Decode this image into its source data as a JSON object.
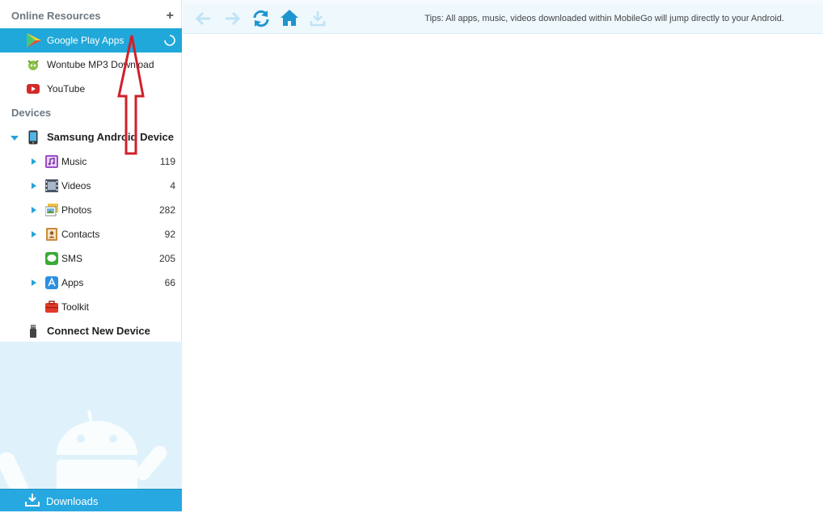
{
  "sidebar": {
    "online_resources": {
      "title": "Online Resources",
      "add_label": "+",
      "items": [
        {
          "label": "Google Play Apps",
          "icon": "google-play-icon",
          "active": true
        },
        {
          "label": "Wontube MP3 Download",
          "icon": "wontube-icon"
        },
        {
          "label": "YouTube",
          "icon": "youtube-icon"
        }
      ]
    },
    "devices": {
      "title": "Devices",
      "device_name": "Samsung Android Device",
      "categories": [
        {
          "label": "Music",
          "count": "119",
          "icon": "music-icon"
        },
        {
          "label": "Videos",
          "count": "4",
          "icon": "video-icon"
        },
        {
          "label": "Photos",
          "count": "282",
          "icon": "photos-icon"
        },
        {
          "label": "Contacts",
          "count": "92",
          "icon": "contacts-icon"
        },
        {
          "label": "SMS",
          "count": "205",
          "icon": "sms-icon"
        },
        {
          "label": "Apps",
          "count": "66",
          "icon": "apps-icon"
        },
        {
          "label": "Toolkit",
          "count": "",
          "icon": "toolkit-icon"
        }
      ],
      "connect_label": "Connect New Device"
    },
    "downloads_label": "Downloads"
  },
  "toolbar": {
    "tips": "Tips: All apps, music, videos downloaded within MobileGo will jump directly to your Android."
  },
  "colors": {
    "accent": "#1fa8d9",
    "toolbar_bg": "#eef8fd",
    "panel_bg": "#dff2fb",
    "annotation_arrow": "#d0202a"
  }
}
